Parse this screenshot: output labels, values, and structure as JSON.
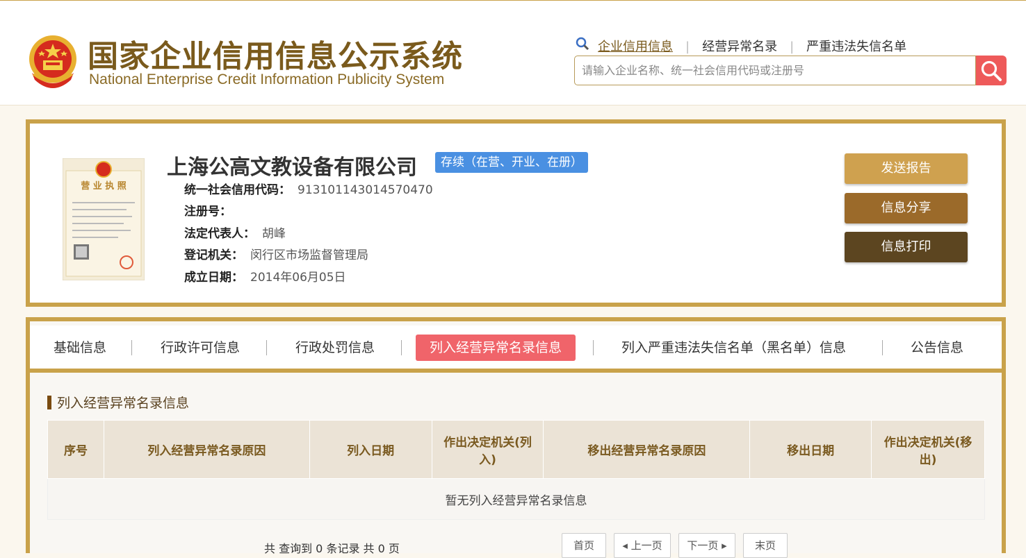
{
  "header": {
    "title_cn": "国家企业信用信息公示系统",
    "title_en": "National Enterprise Credit Information Publicity System",
    "links": [
      "企业信用信息",
      "经营异常名录",
      "严重违法失信名单"
    ],
    "search_placeholder": "请输入企业名称、统一社会信用代码或注册号"
  },
  "company": {
    "name": "上海公高文教设备有限公司",
    "status": "存续（在营、开业、在册）",
    "fields": [
      {
        "label": "统一社会信用代码：",
        "value": "913101143014570470"
      },
      {
        "label": "注册号：",
        "value": ""
      },
      {
        "label": "法定代表人：",
        "value": "胡峰"
      },
      {
        "label": "登记机关：",
        "value": "闵行区市场监督管理局"
      },
      {
        "label": "成立日期：",
        "value": "2014年06月05日"
      }
    ],
    "license_label": "营业执照"
  },
  "actions": {
    "send": "发送报告",
    "share": "信息分享",
    "print": "信息打印"
  },
  "tabs": [
    "基础信息",
    "行政许可信息",
    "行政处罚信息",
    "列入经营异常名录信息",
    "列入严重违法失信名单（黑名单）信息",
    "公告信息"
  ],
  "section": {
    "title": "列入经营异常名录信息",
    "columns": [
      "序号",
      "列入经营异常名录原因",
      "列入日期",
      "作出决定机关(列入)",
      "移出经营异常名录原因",
      "移出日期",
      "作出决定机关(移出)"
    ],
    "empty_text": "暂无列入经营异常名录信息"
  },
  "pager": {
    "summary": "共 查询到 0 条记录 共 0 页",
    "first": "首页",
    "prev": "上一页",
    "next": "下一页",
    "last": "末页"
  }
}
